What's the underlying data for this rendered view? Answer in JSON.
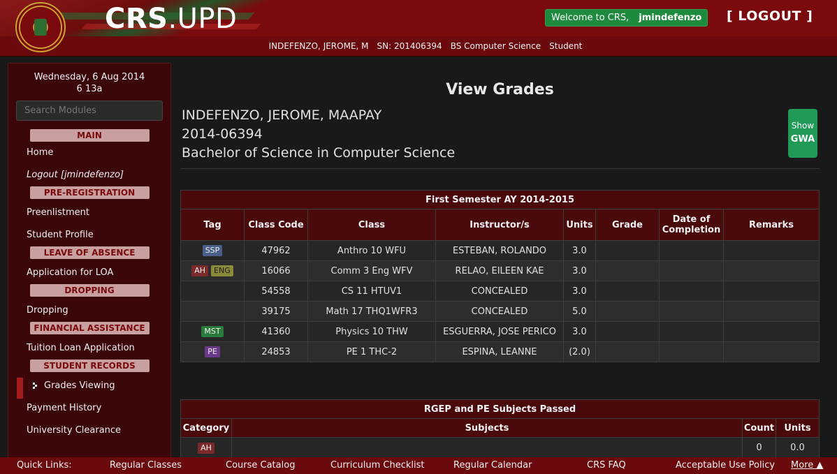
{
  "header": {
    "brand_bold": "CRS",
    "brand_light": ".UPD",
    "welcome_text": "Welcome to CRS,",
    "username": "jmindefenzo",
    "logout_label": "[ LOGOUT ]"
  },
  "subheader": {
    "name": "INDEFENZO, JEROME, M",
    "sn": "SN: 201406394",
    "program": "BS Computer Science",
    "role": "Student"
  },
  "sidebar": {
    "date_line1": "Wednesday, 6 Aug 2014",
    "date_line2": "6 13a",
    "search_placeholder": "Search Modules",
    "sections": {
      "main": "MAIN",
      "prereg": "PRE-REGISTRATION",
      "loa": "LEAVE OF ABSENCE",
      "dropping": "DROPPING",
      "finance": "FINANCIAL ASSISTANCE",
      "records": "STUDENT RECORDS"
    },
    "items": {
      "home": "Home",
      "logout": "Logout [jmindefenzo]",
      "preenlistment": "Preenlistment",
      "profile": "Student Profile",
      "loa": "Application for LOA",
      "dropping": "Dropping",
      "tuition": "Tuition Loan Application",
      "grades": "Grades Viewing",
      "payment": "Payment History",
      "clearance": "University Clearance"
    }
  },
  "main": {
    "title": "View Grades",
    "student_name": "INDEFENZO, JEROME, MAAPAY",
    "student_number": "2014-06394",
    "program": "Bachelor of Science in Computer Science",
    "gwa_show": "Show",
    "gwa_label": "GWA"
  },
  "grades_table": {
    "caption": "First Semester AY 2014-2015",
    "headers": [
      "Tag",
      "Class Code",
      "Class",
      "Instructor/s",
      "Units",
      "Grade",
      "Date of Completion",
      "Remarks"
    ],
    "rows": [
      {
        "tags": [
          "SSP"
        ],
        "code": "47962",
        "class": "Anthro 10 WFU",
        "instructor": "ESTEBAN, ROLANDO",
        "units": "3.0",
        "grade": "",
        "date": "",
        "remarks": ""
      },
      {
        "tags": [
          "AH",
          "ENG"
        ],
        "code": "16066",
        "class": "Comm 3 Eng WFV",
        "instructor": "RELAO, EILEEN KAE",
        "units": "3.0",
        "grade": "",
        "date": "",
        "remarks": ""
      },
      {
        "tags": [],
        "code": "54558",
        "class": "CS 11 HTUV1",
        "instructor": "CONCEALED",
        "units": "3.0",
        "grade": "",
        "date": "",
        "remarks": ""
      },
      {
        "tags": [],
        "code": "39175",
        "class": "Math 17 THQ1WFR3",
        "instructor": "CONCEALED",
        "units": "5.0",
        "grade": "",
        "date": "",
        "remarks": ""
      },
      {
        "tags": [
          "MST"
        ],
        "code": "41360",
        "class": "Physics 10 THW",
        "instructor": "ESGUERRA, JOSE PERICO",
        "units": "3.0",
        "grade": "",
        "date": "",
        "remarks": ""
      },
      {
        "tags": [
          "PE"
        ],
        "code": "24853",
        "class": "PE 1 THC-2",
        "instructor": "ESPINA, LEANNE",
        "units": "(2.0)",
        "grade": "",
        "date": "",
        "remarks": ""
      }
    ]
  },
  "rgep_table": {
    "caption": "RGEP and PE Subjects Passed",
    "headers": [
      "Category",
      "Subjects",
      "Count",
      "Units"
    ],
    "rows": [
      {
        "category": "AH",
        "subjects": "",
        "count": "0",
        "units": "0.0"
      }
    ]
  },
  "footer": {
    "quick_links": "Quick Links:",
    "links": [
      "Regular Classes",
      "Course Catalog",
      "Curriculum Checklist",
      "Regular Calendar",
      "CRS FAQ",
      "Acceptable Use Policy"
    ],
    "more": "More ▲"
  }
}
